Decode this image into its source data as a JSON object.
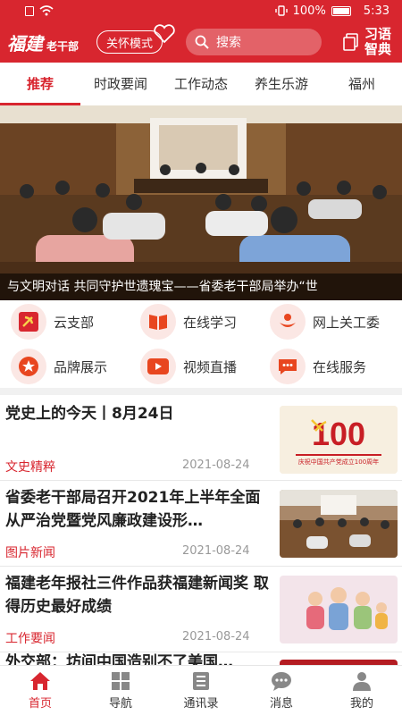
{
  "status": {
    "battery": "100%",
    "time": "5:33"
  },
  "header": {
    "logo_main": "福建",
    "logo_sub": "老干部",
    "care_mode": "关怀模式",
    "search_placeholder": "搜索",
    "dict_line1": "习语",
    "dict_line2": "智典",
    "brand_color": "#d8262f"
  },
  "tabs": [
    {
      "label": "推荐",
      "active": true
    },
    {
      "label": "时政要闻"
    },
    {
      "label": "工作动态"
    },
    {
      "label": "养生乐游"
    },
    {
      "label": "福州"
    }
  ],
  "banner": {
    "caption": "与文明对话 共同守护世遗瑰宝——省委老干部局举办“世"
  },
  "grid": [
    {
      "label": "云支部",
      "icon": "party-emblem-icon"
    },
    {
      "label": "在线学习",
      "icon": "book-icon"
    },
    {
      "label": "网上关工委",
      "icon": "people-care-icon"
    },
    {
      "label": "品牌展示",
      "icon": "star-badge-icon"
    },
    {
      "label": "视频直播",
      "icon": "video-play-icon"
    },
    {
      "label": "在线服务",
      "icon": "chat-service-icon"
    }
  ],
  "news": [
    {
      "title": "党史上的今天丨8月24日",
      "tag": "文史精粹",
      "date": "2021-08-24",
      "thumb_text": "100",
      "thumb_sub": "庆祝中国共产党成立100周年"
    },
    {
      "title": "省委老干部局召开2021年上半年全面从严治党暨党风廉政建设形…",
      "tag": "图片新闻",
      "date": "2021-08-24"
    },
    {
      "title": "福建老年报社三件作品获福建新闻奖 取得历史最好成绩",
      "tag": "工作要闻",
      "date": "2021-08-24"
    },
    {
      "title": "外交部：坊间中国造别不了美国…",
      "tag": "",
      "date": ""
    }
  ],
  "bottom_nav": [
    {
      "label": "首页",
      "icon": "home-icon",
      "active": true
    },
    {
      "label": "导航",
      "icon": "grid-icon"
    },
    {
      "label": "通讯录",
      "icon": "contacts-icon"
    },
    {
      "label": "消息",
      "icon": "message-icon"
    },
    {
      "label": "我的",
      "icon": "user-icon"
    }
  ]
}
